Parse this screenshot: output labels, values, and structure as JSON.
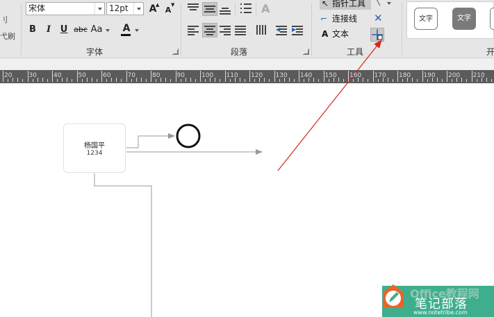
{
  "ribbon": {
    "left_cut": [
      "刂",
      "弋刷"
    ],
    "font": {
      "group_label": "字体",
      "font_name": "宋体",
      "font_size": "12pt",
      "grow_label": "A",
      "shrink_label": "A",
      "bold_label": "B",
      "italic_label": "I",
      "underline_label": "U",
      "strike_label": "abc",
      "case_label": "Aa",
      "color_label": "A"
    },
    "paragraph": {
      "group_label": "段落"
    },
    "tools": {
      "group_label": "工具",
      "pointer_label": "指针工具",
      "connector_label": "连接线",
      "text_glyph": "A",
      "text_label": "文本"
    },
    "styles": {
      "box1_label": "文字",
      "box2_label": "文字",
      "cut_label": "开"
    }
  },
  "ruler": {
    "labels": [
      "20",
      "30",
      "40",
      "50",
      "60",
      "70",
      "80",
      "90",
      "100",
      "110",
      "120",
      "130",
      "140",
      "150",
      "160",
      "170",
      "180",
      "190",
      "200",
      "210"
    ]
  },
  "diagram": {
    "node": {
      "name": "杨国平",
      "id": "1234"
    }
  },
  "watermark": {
    "title": "笔记部落",
    "url": "www.notetribe.com",
    "office": "Office教程网"
  },
  "colors": {
    "ribbon_bg": "#e6e6e6",
    "ruler_strip": "#5b5b5b",
    "arrow_red": "#d9231d",
    "connector_gray": "#999999",
    "watermark_green": "#3fae8d"
  }
}
